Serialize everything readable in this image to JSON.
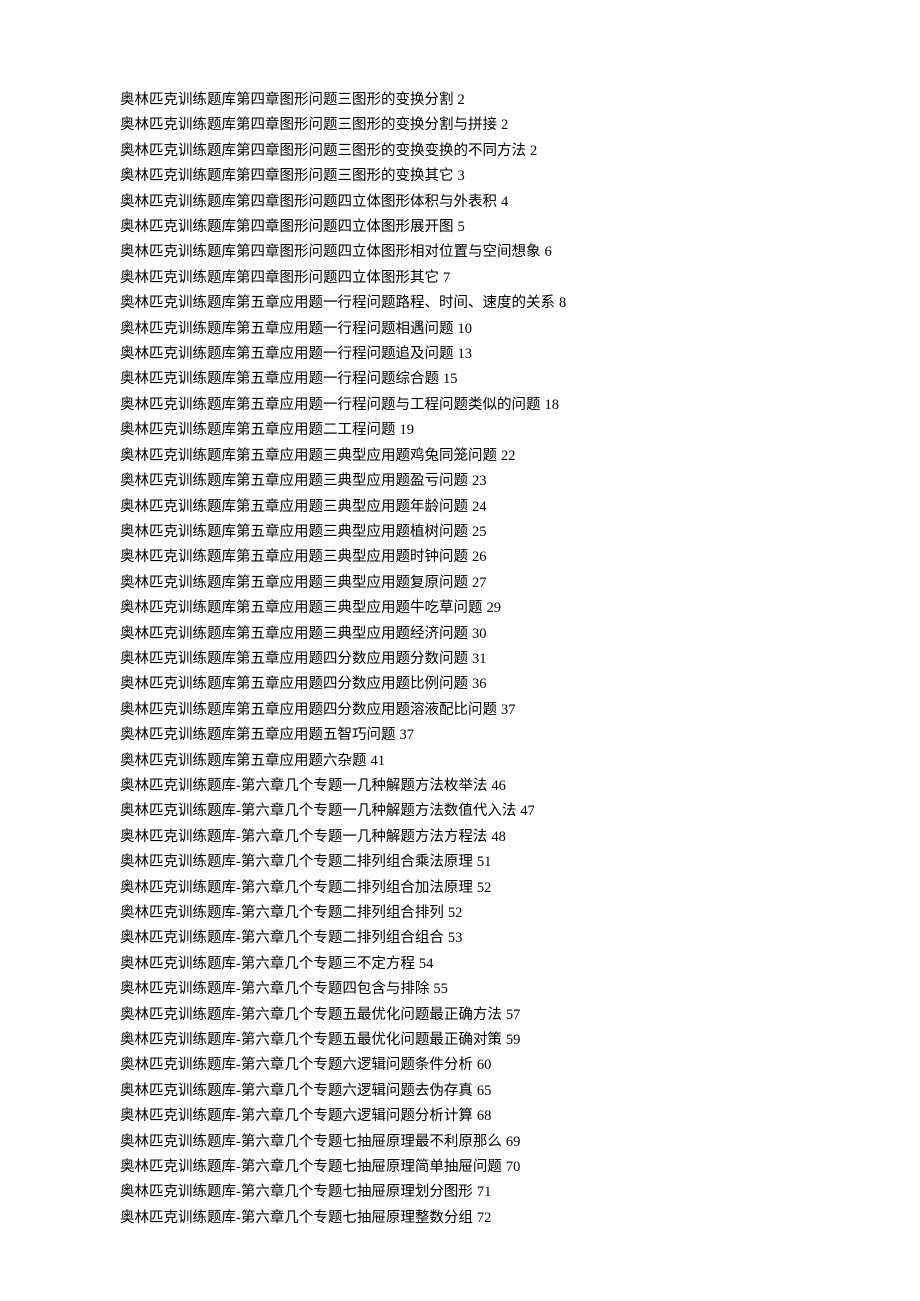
{
  "toc": [
    {
      "title": "奥林匹克训练题库第四章图形问题三图形的变换分割",
      "page": "2"
    },
    {
      "title": "奥林匹克训练题库第四章图形问题三图形的变换分割与拼接",
      "page": "2"
    },
    {
      "title": "奥林匹克训练题库第四章图形问题三图形的变换变换的不同方法",
      "page": "2"
    },
    {
      "title": "奥林匹克训练题库第四章图形问题三图形的变换其它",
      "page": "3"
    },
    {
      "title": "奥林匹克训练题库第四章图形问题四立体图形体积与外表积",
      "page": "4"
    },
    {
      "title": "奥林匹克训练题库第四章图形问题四立体图形展开图",
      "page": "5"
    },
    {
      "title": "奥林匹克训练题库第四章图形问题四立体图形相对位置与空间想象",
      "page": "6"
    },
    {
      "title": "奥林匹克训练题库第四章图形问题四立体图形其它",
      "page": "7"
    },
    {
      "title": "奥林匹克训练题库第五章应用题一行程问题路程、时间、速度的关系",
      "page": "8"
    },
    {
      "title": "奥林匹克训练题库第五章应用题一行程问题相遇问题",
      "page": "10"
    },
    {
      "title": "奥林匹克训练题库第五章应用题一行程问题追及问题",
      "page": "13"
    },
    {
      "title": "奥林匹克训练题库第五章应用题一行程问题综合题",
      "page": "15"
    },
    {
      "title": "奥林匹克训练题库第五章应用题一行程问题与工程问题类似的问题",
      "page": "18"
    },
    {
      "title": "奥林匹克训练题库第五章应用题二工程问题",
      "page": "19"
    },
    {
      "title": "奥林匹克训练题库第五章应用题三典型应用题鸡兔同笼问题",
      "page": "22"
    },
    {
      "title": "奥林匹克训练题库第五章应用题三典型应用题盈亏问题",
      "page": "23"
    },
    {
      "title": "奥林匹克训练题库第五章应用题三典型应用题年龄问题",
      "page": "24"
    },
    {
      "title": "奥林匹克训练题库第五章应用题三典型应用题植树问题",
      "page": "25"
    },
    {
      "title": "奥林匹克训练题库第五章应用题三典型应用题时钟问题",
      "page": "26"
    },
    {
      "title": "奥林匹克训练题库第五章应用题三典型应用题复原问题",
      "page": "27"
    },
    {
      "title": "奥林匹克训练题库第五章应用题三典型应用题牛吃草问题",
      "page": "29"
    },
    {
      "title": "奥林匹克训练题库第五章应用题三典型应用题经济问题",
      "page": "30"
    },
    {
      "title": "奥林匹克训练题库第五章应用题四分数应用题分数问题",
      "page": "31"
    },
    {
      "title": "奥林匹克训练题库第五章应用题四分数应用题比例问题",
      "page": "36"
    },
    {
      "title": "奥林匹克训练题库第五章应用题四分数应用题溶液配比问题",
      "page": "37"
    },
    {
      "title": "奥林匹克训练题库第五章应用题五智巧问题",
      "page": "37"
    },
    {
      "title": "奥林匹克训练题库第五章应用题六杂题",
      "page": "41"
    },
    {
      "title": "奥林匹克训练题库-第六章几个专题一几种解题方法枚举法",
      "page": "46"
    },
    {
      "title": "奥林匹克训练题库-第六章几个专题一几种解题方法数值代入法",
      "page": "47"
    },
    {
      "title": "奥林匹克训练题库-第六章几个专题一几种解题方法方程法",
      "page": "48"
    },
    {
      "title": "奥林匹克训练题库-第六章几个专题二排列组合乘法原理",
      "page": "51"
    },
    {
      "title": "奥林匹克训练题库-第六章几个专题二排列组合加法原理",
      "page": "52"
    },
    {
      "title": "奥林匹克训练题库-第六章几个专题二排列组合排列",
      "page": "52"
    },
    {
      "title": "奥林匹克训练题库-第六章几个专题二排列组合组合",
      "page": "53"
    },
    {
      "title": "奥林匹克训练题库-第六章几个专题三不定方程",
      "page": "54"
    },
    {
      "title": "奥林匹克训练题库-第六章几个专题四包含与排除",
      "page": "55"
    },
    {
      "title": "奥林匹克训练题库-第六章几个专题五最优化问题最正确方法",
      "page": "57"
    },
    {
      "title": "奥林匹克训练题库-第六章几个专题五最优化问题最正确对策",
      "page": "59"
    },
    {
      "title": "奥林匹克训练题库-第六章几个专题六逻辑问题条件分析",
      "page": "60"
    },
    {
      "title": "奥林匹克训练题库-第六章几个专题六逻辑问题去伪存真",
      "page": "65"
    },
    {
      "title": "奥林匹克训练题库-第六章几个专题六逻辑问题分析计算",
      "page": "68"
    },
    {
      "title": "奥林匹克训练题库-第六章几个专题七抽屉原理最不利原那么",
      "page": "69"
    },
    {
      "title": "奥林匹克训练题库-第六章几个专题七抽屉原理简单抽屉问题",
      "page": "70"
    },
    {
      "title": "奥林匹克训练题库-第六章几个专题七抽屉原理划分图形",
      "page": "71"
    },
    {
      "title": "奥林匹克训练题库-第六章几个专题七抽屉原理整数分组",
      "page": "72"
    }
  ]
}
